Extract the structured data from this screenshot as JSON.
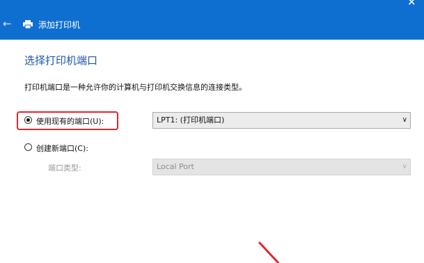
{
  "window": {
    "title": "添加打印机",
    "back_icon": "back-arrow-icon",
    "printer_icon": "printer-icon"
  },
  "page": {
    "heading": "选择打印机端口",
    "description": "打印机端口是一种允许你的计算机与打印机交换信息的连接类型。"
  },
  "options": {
    "existing": {
      "label": "使用现有的端口(U):",
      "checked": true,
      "selected_value": "LPT1: (打印机端口)"
    },
    "new": {
      "label": "创建新端口(C):",
      "checked": false,
      "port_type_label": "端口类型:",
      "port_type_value": "Local Port"
    }
  },
  "colors": {
    "titlebar": "#0f6fd1",
    "heading": "#1d56a8",
    "highlight": "#e2252b"
  }
}
